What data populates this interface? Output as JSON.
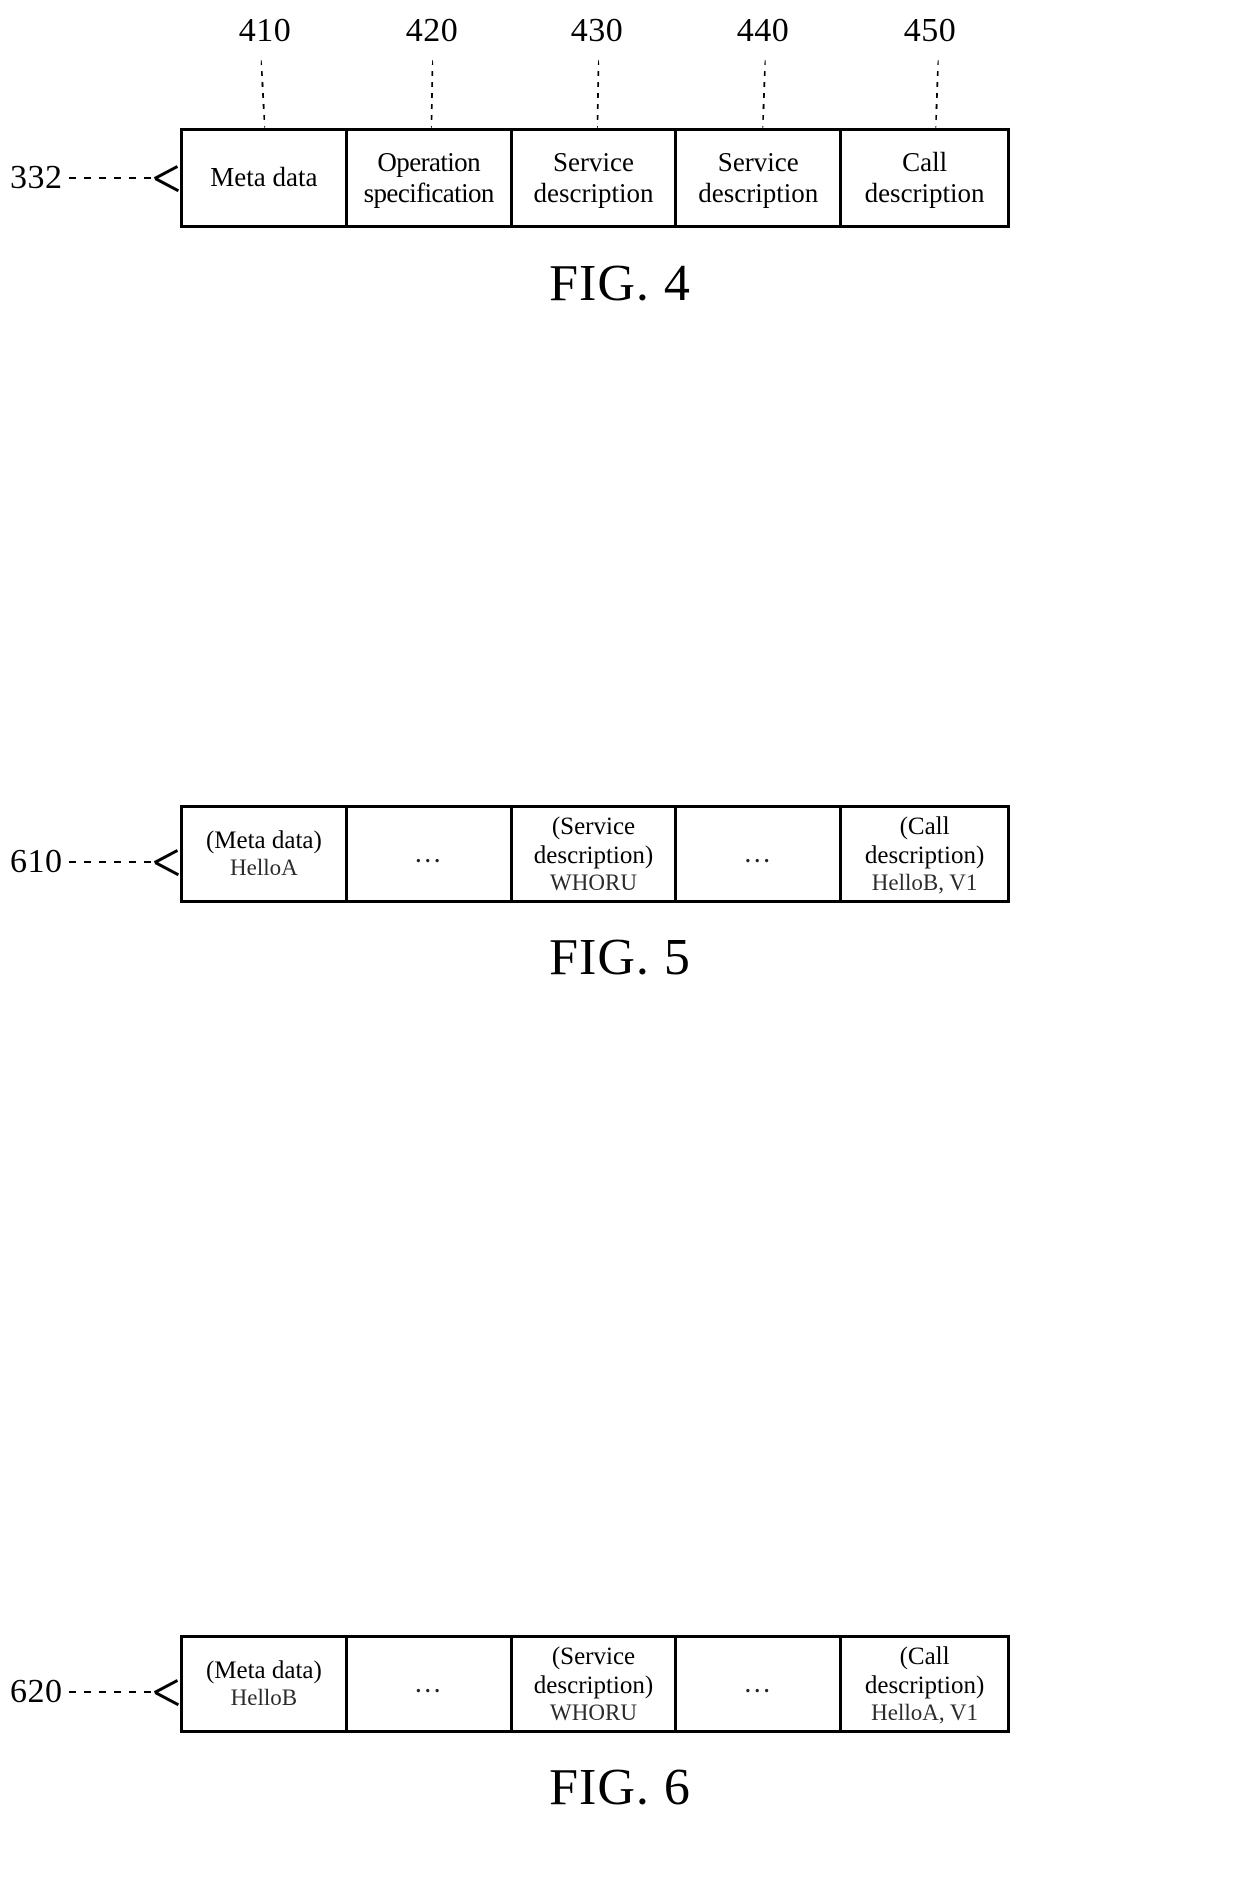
{
  "document": {
    "type": "patent-drawing-sheet",
    "figures": [
      {
        "id": "fig4",
        "caption": "FIG. 4",
        "pointer_label": "332",
        "callouts": [
          {
            "number": "410"
          },
          {
            "number": "420"
          },
          {
            "number": "430"
          },
          {
            "number": "440"
          },
          {
            "number": "450"
          }
        ],
        "cells": [
          {
            "lines": [
              "Meta data"
            ]
          },
          {
            "lines": [
              "Operation",
              "specification"
            ]
          },
          {
            "lines": [
              "Service",
              "description"
            ]
          },
          {
            "lines": [
              "Service",
              "description"
            ]
          },
          {
            "lines": [
              "Call",
              "description"
            ]
          }
        ]
      },
      {
        "id": "fig5",
        "caption": "FIG. 5",
        "pointer_label": "610",
        "cells": [
          {
            "lines": [
              "(Meta data)"
            ],
            "value": "HelloA"
          },
          {
            "lines": [
              "…"
            ],
            "ellipsis": true
          },
          {
            "lines": [
              "(Service",
              "description)"
            ],
            "value": "WHORU"
          },
          {
            "lines": [
              "…"
            ],
            "ellipsis": true
          },
          {
            "lines": [
              "(Call",
              "description)"
            ],
            "value": "HelloB, V1"
          }
        ]
      },
      {
        "id": "fig6",
        "caption": "FIG. 6",
        "pointer_label": "620",
        "cells": [
          {
            "lines": [
              "(Meta data)"
            ],
            "value": "HelloB"
          },
          {
            "lines": [
              "…"
            ],
            "ellipsis": true
          },
          {
            "lines": [
              "(Service",
              "description)"
            ],
            "value": "WHORU"
          },
          {
            "lines": [
              "…"
            ],
            "ellipsis": true
          },
          {
            "lines": [
              "(Call",
              "description)"
            ],
            "value": "HelloA, V1"
          }
        ]
      }
    ]
  },
  "fig4": {
    "caption": "FIG. 4",
    "pointer_label": "332",
    "callout_0": "410",
    "callout_1": "420",
    "callout_2": "430",
    "callout_3": "440",
    "callout_4": "450",
    "cell_0_l0": "Meta data",
    "cell_1_l0": "Operation",
    "cell_1_l1": "specification",
    "cell_2_l0": "Service",
    "cell_2_l1": "description",
    "cell_3_l0": "Service",
    "cell_3_l1": "description",
    "cell_4_l0": "Call",
    "cell_4_l1": "description"
  },
  "fig5": {
    "caption": "FIG. 5",
    "pointer_label": "610",
    "cell_0_l0": "(Meta data)",
    "cell_0_val": "HelloA",
    "cell_1_dots": "…",
    "cell_2_l0": "(Service",
    "cell_2_l1": "description)",
    "cell_2_val": "WHORU",
    "cell_3_dots": "…",
    "cell_4_l0": "(Call",
    "cell_4_l1": "description)",
    "cell_4_val": "HelloB, V1"
  },
  "fig6": {
    "caption": "FIG. 6",
    "pointer_label": "620",
    "cell_0_l0": "(Meta data)",
    "cell_0_val": "HelloB",
    "cell_1_dots": "…",
    "cell_2_l0": "(Service",
    "cell_2_l1": "description)",
    "cell_2_val": "WHORU",
    "cell_3_dots": "…",
    "cell_4_l0": "(Call",
    "cell_4_l1": "description)",
    "cell_4_val": "HelloA, V1"
  },
  "colors": {
    "ink": "#000000",
    "paper": "#ffffff"
  }
}
